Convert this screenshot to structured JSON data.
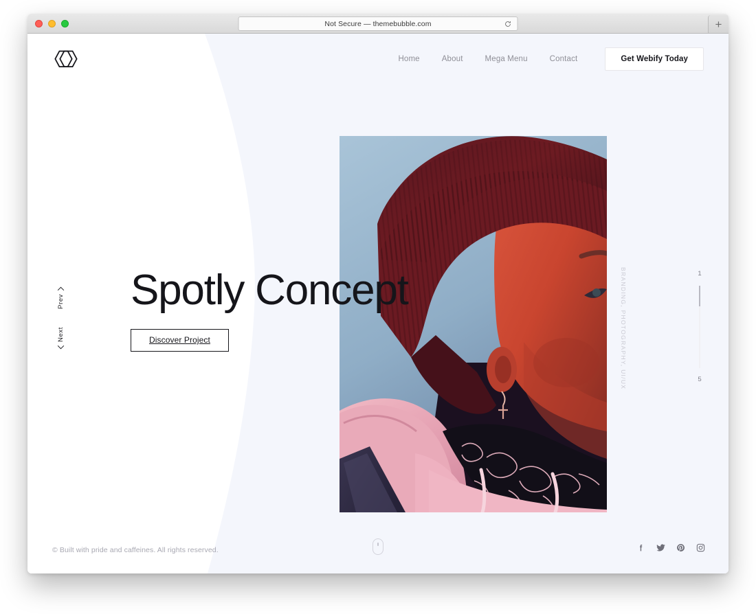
{
  "browser": {
    "url_text": "Not Secure — themebubble.com",
    "reload_icon": "reload-icon",
    "new_tab_label": "+",
    "traffic_lights": [
      "close",
      "minimize",
      "zoom"
    ]
  },
  "header": {
    "logo_name": "webify-logo",
    "nav": [
      {
        "label": "Home"
      },
      {
        "label": "About"
      },
      {
        "label": "Mega Menu"
      },
      {
        "label": "Contact"
      }
    ],
    "cta_label": "Get Webify Today"
  },
  "slider": {
    "prev_label": "Prev",
    "next_label": "Next",
    "prev_icon": "chevron-up-icon",
    "next_icon": "chevron-down-icon",
    "current": "1",
    "total": "5",
    "progress_percent": 25
  },
  "hero": {
    "title": "Spotly Concept",
    "button_label": "Discover Project",
    "categories": "BRANDING, PHOTOGRAPHY, UI/UX",
    "image_alt": "Portrait of a person wearing a dark red beanie, pink hoodie and paisley bandana against a blue sky"
  },
  "footer": {
    "copyright": "© Built with pride and caffeines. All rights reserved.",
    "scroll_icon": "mouse-scroll-icon",
    "socials": [
      {
        "name": "facebook-icon",
        "glyph": "f"
      },
      {
        "name": "twitter-icon",
        "glyph": "t"
      },
      {
        "name": "pinterest-icon",
        "glyph": "p"
      },
      {
        "name": "instagram-icon",
        "glyph": "i"
      }
    ]
  },
  "colors": {
    "text_dark": "#15151a",
    "text_muted": "#8f8f97",
    "bg_curve": "#f3f5fc",
    "accent_border": "#e6e6ea"
  }
}
